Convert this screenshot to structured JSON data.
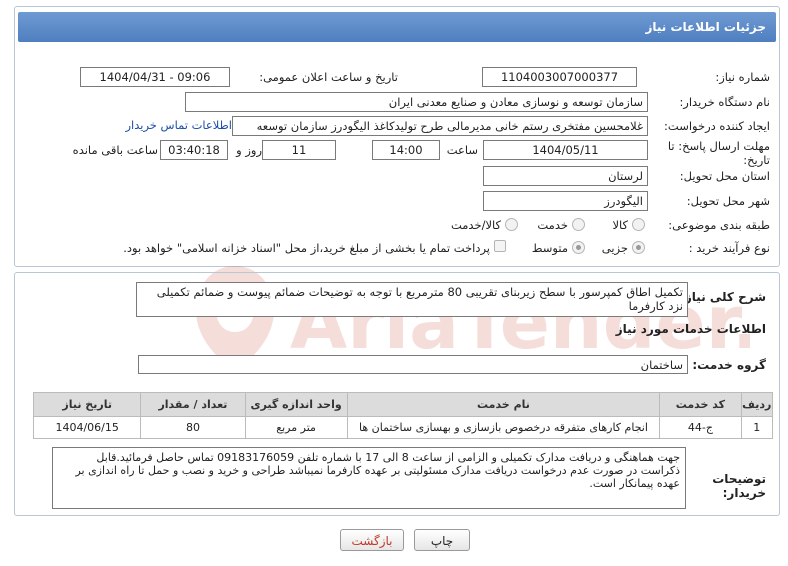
{
  "header": {
    "title": "جزئیات اطلاعات نیاز"
  },
  "labels": {
    "need_number": "شماره نیاز:",
    "announce_datetime": "تاریخ و ساعت اعلان عمومی:",
    "buyer_org": "نام دستگاه خریدار:",
    "requester": "ایجاد کننده درخواست:",
    "deadline": "مهلت ارسال پاسخ: تا تاریخ:",
    "time_word": "ساعت",
    "day_word": "روز و",
    "remaining": "ساعت باقی مانده",
    "province": "استان محل تحویل:",
    "city": "شهر محل تحویل:",
    "category": "طبقه بندی موضوعی:",
    "purchase_type": "نوع فرآیند خرید :"
  },
  "fields": {
    "need_number": "1104003007000377",
    "announce_datetime": "1404/04/31 - 09:06",
    "buyer_org": "سازمان توسعه و نوسازی معادن و صنایع معدنی ایران",
    "requester": "غلامحسین مفتخری رستم خانی مدیرمالی طرح تولیدکاغذ الیگودرز سازمان توسعه",
    "contact_link": "اطلاعات تماس خریدار",
    "deadline_date": "1404/05/11",
    "deadline_time": "14:00",
    "days": "11",
    "remaining_time": "03:40:18",
    "province": "لرستان",
    "city": "الیگودرز"
  },
  "category_options": [
    "کالا",
    "خدمت",
    "کالا/خدمت"
  ],
  "category_selected": "خدمت",
  "purchase_options": [
    "جزیی",
    "متوسط"
  ],
  "purchase_selected": "جزیی",
  "payment_note": "پرداخت تمام یا بخشی از مبلغ خرید،از محل \"اسناد خزانه اسلامی\" خواهد بود.",
  "description": {
    "label": "شرح کلی نیاز:",
    "text": "تکمیل اطاق کمپرسور با سطح زیربنای تقریبی 80 مترمربع با توجه به توضیحات ضمائم پیوست و ضمائم تکمیلی نزد کارفرما"
  },
  "services": {
    "section_title": "اطلاعات خدمات مورد نیاز",
    "group_label": "گروه خدمت:",
    "group_value": "ساختمان",
    "columns": [
      "ردیف",
      "کد خدمت",
      "نام خدمت",
      "واحد اندازه گیری",
      "تعداد / مقدار",
      "تاریخ نیاز"
    ],
    "rows": [
      [
        "1",
        "ج-44",
        "انجام کارهای متفرقه درخصوص بازسازی و بهسازی ساختمان ها",
        "متر مربع",
        "80",
        "1404/06/15"
      ]
    ]
  },
  "buyer_notes": {
    "label": "توضیحات خریدار:",
    "text": "جهت هماهنگی و دریافت مدارک تکمیلی و الزامی از ساعت 8 الی 17 با شماره تلفن 09183176059 تماس حاصل فرمائید.قابل ذکراست در صورت عدم درخواست دریافت مدارک مسئولیتی بر عهده کارفرما نمیباشد طراحی و خرید و نصب و حمل تا راه اندازی بر عهده پیمانکار است."
  },
  "buttons": {
    "print": "چاپ",
    "back": "بازگشت"
  },
  "watermark_text": "AriaTender.neT",
  "colors": {
    "header": "#5a88c8",
    "link": "#1e4fa8",
    "back_text": "#c0392b"
  }
}
